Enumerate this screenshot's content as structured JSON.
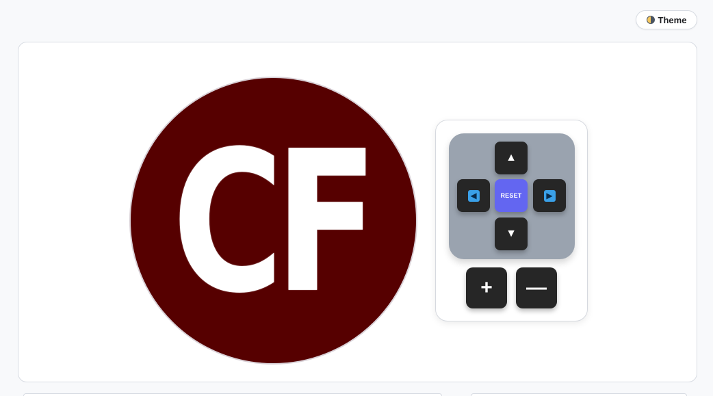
{
  "header": {
    "theme_button_label": "Theme",
    "theme_icon": "half-moon-icon"
  },
  "viewer": {
    "logo_text": "CF",
    "logo_background": "#560000",
    "logo_text_color": "#ffffff"
  },
  "controls": {
    "up_label": "▲",
    "left_label": "◀",
    "reset_label": "RESET",
    "right_label": "▶",
    "down_label": "▼",
    "zoom_in_label": "+",
    "zoom_out_label": "—",
    "accent_color": "#6366f1",
    "dpad_background": "#9aa3af",
    "button_color": "#262626"
  }
}
